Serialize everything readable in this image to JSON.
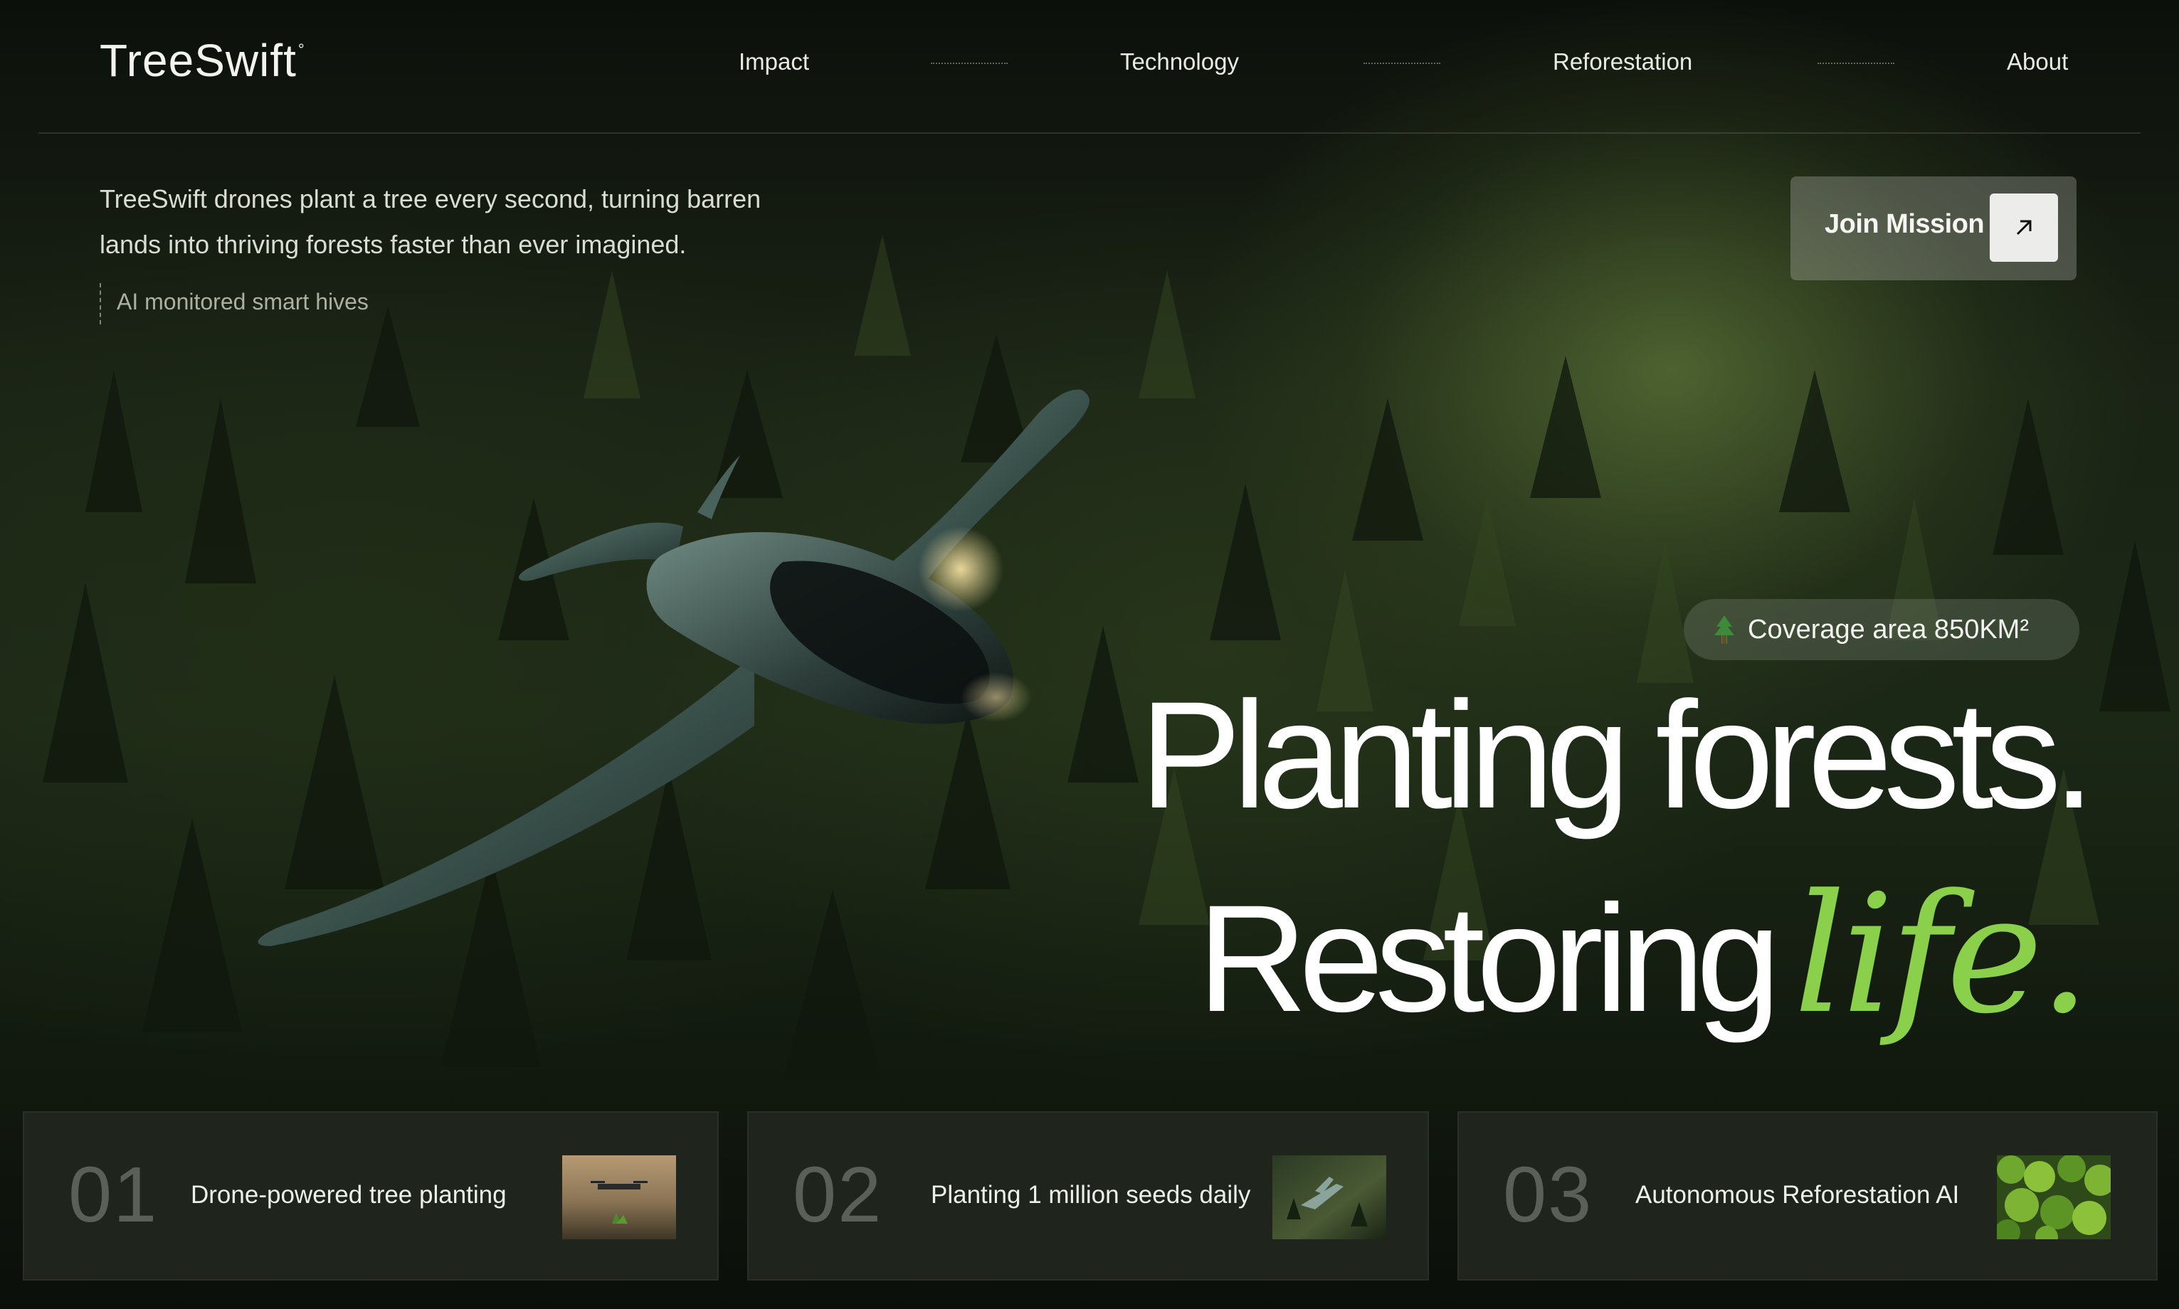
{
  "brand": {
    "name": "TreeSwift",
    "mark": "°"
  },
  "nav": {
    "items": [
      {
        "label": "Impact"
      },
      {
        "label": "Technology"
      },
      {
        "label": "Reforestation"
      },
      {
        "label": "About"
      }
    ]
  },
  "intro": {
    "line1": "TreeSwift drones plant a tree every second, turning barren",
    "line2": "lands into thriving forests faster than ever imagined.",
    "tagline": "AI monitored smart hives"
  },
  "cta": {
    "label": "Join Mission",
    "icon": "arrow-up-right-icon"
  },
  "coverage": {
    "icon": "tree-icon",
    "label": "Coverage area 850KM²"
  },
  "headline": {
    "line1": "Planting forests.",
    "line2_main": "Restoring",
    "line2_accent": "life."
  },
  "colors": {
    "accent": "#8bd04a",
    "background": "#1a2315"
  },
  "cards": [
    {
      "number": "01",
      "label": "Drone-powered tree planting"
    },
    {
      "number": "02",
      "label": "Planting 1 million seeds daily"
    },
    {
      "number": "03",
      "label": "Autonomous Reforestation AI"
    }
  ]
}
